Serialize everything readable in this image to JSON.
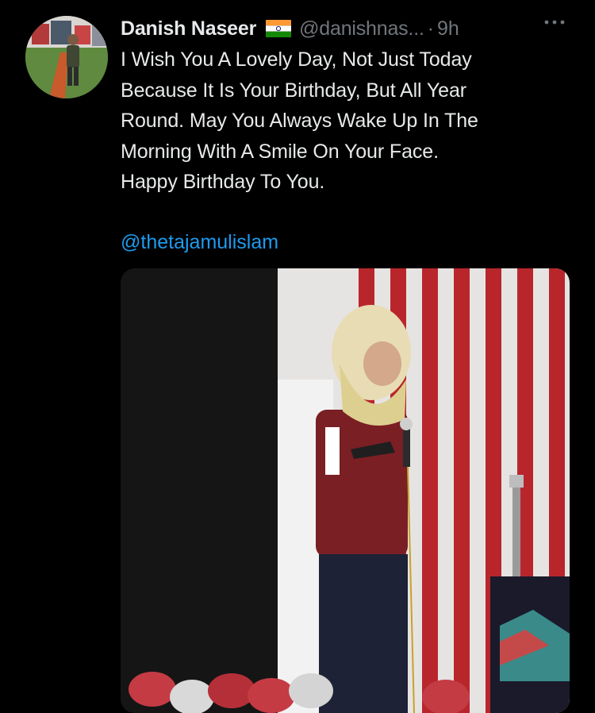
{
  "tweet": {
    "author_name": "Danish Naseer",
    "flag_icon": "india-flag-icon",
    "handle": "@danishnas...",
    "separator": "·",
    "time": "9h",
    "more_icon": "more-options-icon",
    "text": "I Wish You A Lovely Day, Not Just Today\nBecause It Is Your Birthday, But All Year\nRound. May You Always Wake Up In The\nMorning With A Smile On Your Face.\nHappy Birthday To You.",
    "mention": "@thetajamulislam"
  },
  "colors": {
    "background": "#000000",
    "text_primary": "#e7e9ea",
    "text_secondary": "#71767b",
    "link": "#1d9bf0"
  }
}
